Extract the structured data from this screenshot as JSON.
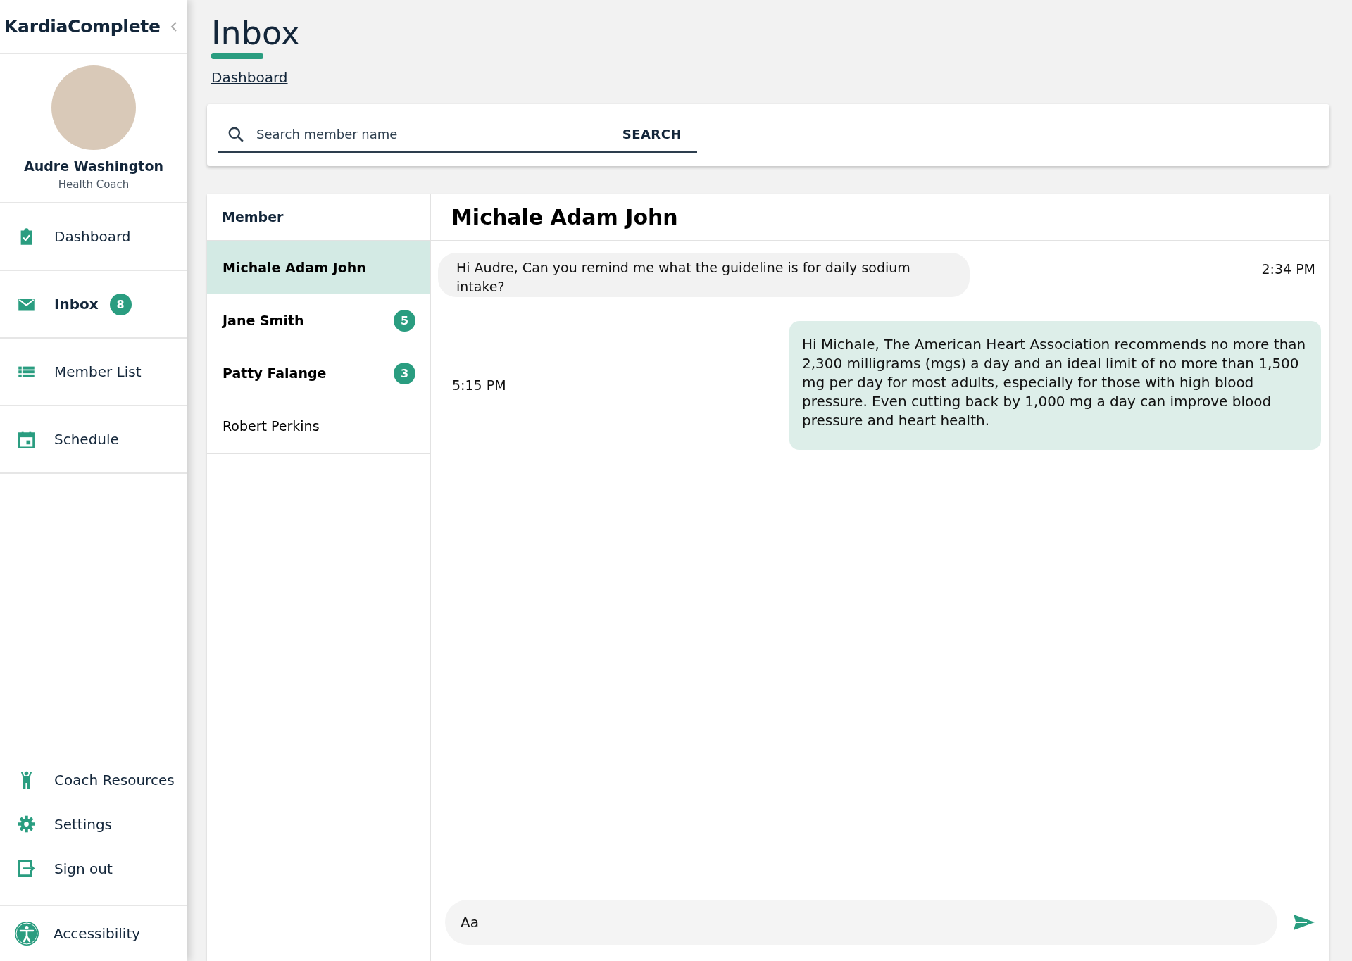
{
  "sidebar": {
    "brand": "KardiaComplete",
    "profile": {
      "name": "Audre Washington",
      "role": "Health Coach"
    },
    "nav": [
      {
        "label": "Dashboard",
        "selected": false
      },
      {
        "label": "Inbox",
        "selected": true,
        "badge": "8"
      },
      {
        "label": "Member List",
        "selected": false
      },
      {
        "label": "Schedule",
        "selected": false
      }
    ],
    "bottom_nav": [
      "Coach Resources",
      "Settings",
      "Sign out"
    ],
    "accessibility": "Accessibility"
  },
  "page": {
    "title": "Inbox",
    "breadcrumb": "Dashboard"
  },
  "search": {
    "placeholder": "Search member name",
    "button": "SEARCH"
  },
  "members": {
    "heading": "Member",
    "items": [
      {
        "name": "Michale Adam John",
        "selected": true,
        "unread": true
      },
      {
        "name": "Jane Smith",
        "selected": false,
        "unread": true,
        "badge": "5"
      },
      {
        "name": "Patty Falange",
        "selected": false,
        "unread": true,
        "badge": "3"
      },
      {
        "name": "Robert Perkins",
        "selected": false,
        "unread": false
      }
    ]
  },
  "chat": {
    "title": "Michale Adam John",
    "messages": [
      {
        "kind": "incoming",
        "text": "Hi Audre, Can you remind me what the guideline is for daily sodium intake?",
        "time": "2:34 PM"
      },
      {
        "kind": "outgoing",
        "text": "Hi Michale, The American Heart Association recommends no more than 2,300 milligrams (mgs) a day and an ideal limit of no more than 1,500 mg per day for most adults, especially for those with high blood pressure. Even cutting back by 1,000 mg a day can improve blood pressure and heart health.",
        "time": "5:15 PM"
      }
    ],
    "composer": {
      "placeholder": "Aa"
    }
  }
}
